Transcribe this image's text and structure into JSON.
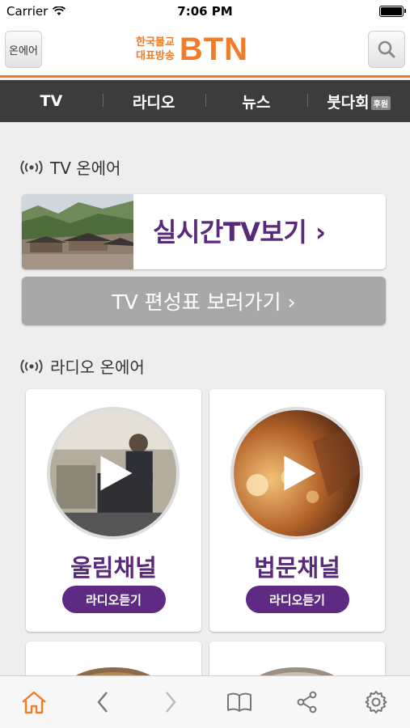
{
  "status_bar": {
    "carrier": "Carrier",
    "time": "7:06 PM"
  },
  "header": {
    "onair_label": "온에어",
    "logo_sub_line1": "한국불교",
    "logo_sub_line2": "대표방송",
    "logo_main": "BTN"
  },
  "nav": {
    "tabs": [
      {
        "label": "TV"
      },
      {
        "label": "라디오"
      },
      {
        "label": "뉴스"
      },
      {
        "label": "붓다회",
        "badge": "후원"
      }
    ]
  },
  "tv_section": {
    "title": "TV 온에어",
    "live_label": "실시간TV보기 ›",
    "schedule_label": "TV 편성표 보러가기  ›"
  },
  "radio_section": {
    "title": "라디오 온에어",
    "channels": [
      {
        "name": "울림채널",
        "button": "라디오듣기"
      },
      {
        "name": "법문채널",
        "button": "라디오듣기"
      }
    ]
  },
  "colors": {
    "brand_orange": "#f07c29",
    "purple": "#5e2a84",
    "nav_bg": "#3c3c3c",
    "accent_home": "#f07c29"
  },
  "toolbar": {
    "icons": [
      "home-icon",
      "back-icon",
      "forward-icon",
      "book-icon",
      "share-icon",
      "settings-icon"
    ]
  }
}
